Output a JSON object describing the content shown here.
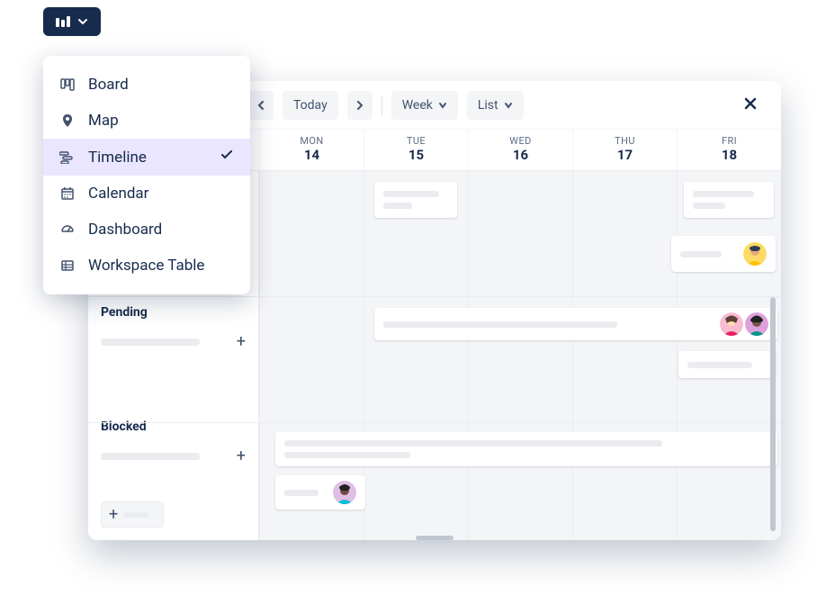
{
  "view_switcher": {
    "icon": "kanban-icon"
  },
  "view_menu": {
    "items": [
      {
        "icon": "kanban-icon",
        "label": "Board",
        "selected": false
      },
      {
        "icon": "map-pin-icon",
        "label": "Map",
        "selected": false
      },
      {
        "icon": "timeline-icon",
        "label": "Timeline",
        "selected": true
      },
      {
        "icon": "calendar-icon",
        "label": "Calendar",
        "selected": false
      },
      {
        "icon": "dashboard-icon",
        "label": "Dashboard",
        "selected": false
      },
      {
        "icon": "table-icon",
        "label": "Workspace Table",
        "selected": false
      }
    ]
  },
  "toolbar": {
    "prev_label": "‹",
    "today_label": "Today",
    "next_label": "›",
    "range_label": "Week",
    "view_label": "List",
    "close_label": "✕"
  },
  "days": [
    {
      "name": "MON",
      "num": "14"
    },
    {
      "name": "TUE",
      "num": "15"
    },
    {
      "name": "WED",
      "num": "16"
    },
    {
      "name": "THU",
      "num": "17"
    },
    {
      "name": "FRI",
      "num": "18"
    }
  ],
  "groups": [
    {
      "title": "Pending"
    },
    {
      "title": "Blocked"
    }
  ],
  "avatars": {
    "yellow": {
      "bg": "#FFD966",
      "skin": "#E8A87C",
      "hair": "#2C3E50"
    },
    "pink": {
      "bg": "#F8BBD0",
      "skin": "#FFE0B2",
      "hair": "#5D4037",
      "shirt": "#E91E63"
    },
    "teal": {
      "bg": "#DDA0DD",
      "skin": "#795548",
      "hair": "#212121",
      "shirt": "#009688"
    },
    "purple": {
      "bg": "#E1BEE7",
      "skin": "#6D4C41",
      "hair": "#212121",
      "shirt": "#00BCD4"
    }
  }
}
